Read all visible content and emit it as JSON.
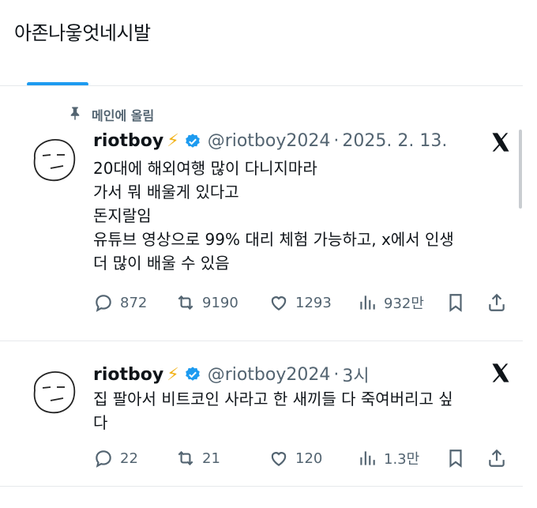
{
  "page": {
    "title": "아존나웋엇네시발"
  },
  "pinned": {
    "label": "메인에 올림",
    "icon": "pin-icon"
  },
  "tweets": [
    {
      "name": "riotboy",
      "emoji": "⚡",
      "handle": "@riotboy2024",
      "separator": "·",
      "date": "2025. 2. 13.",
      "lines": [
        "20대에 해외여행 많이 다니지마라",
        "가서 뭐 배울게 있다고",
        "돈지랄임",
        "유튜브 영상으로 99% 대리 체험 가능하고, x에서 인생",
        "더 많이 배울 수 있음"
      ],
      "replies": "872",
      "retweets": "9190",
      "likes": "1293",
      "views": "932만"
    },
    {
      "name": "riotboy",
      "emoji": "⚡",
      "handle": "@riotboy2024",
      "separator": "·",
      "date": "3시",
      "lines": [
        "집 팔아서 비트코인 사라고 한 새끼들 다 죽여버리고 싶",
        "다"
      ],
      "replies": "22",
      "retweets": "21",
      "likes": "120",
      "views": "1.3만"
    }
  ],
  "colors": {
    "accent": "#1d9bf0",
    "muted": "#536471",
    "text": "#0f1419",
    "bolt": "#f2b31b"
  }
}
